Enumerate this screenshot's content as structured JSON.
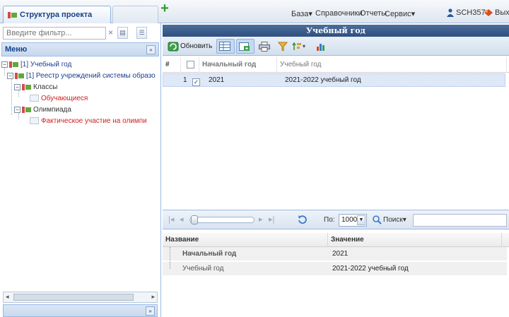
{
  "topbar": {
    "project_tab": "Структура проекта",
    "add_tab": "+",
    "menus": [
      "База▾",
      "Справочники",
      "Отчеты",
      "Сервис▾"
    ],
    "user": "SCH357",
    "exit": "Вых"
  },
  "left": {
    "filter_placeholder": "Введите фильтр...",
    "filter_clear": "×",
    "menu_title": "Меню",
    "tree": [
      {
        "label": "[1] Учебный год",
        "level": 0,
        "type": "folder",
        "color": "blue"
      },
      {
        "label": "[1] Реестр учреждений системы образо",
        "level": 1,
        "type": "folder",
        "color": "blue"
      },
      {
        "label": "Классы",
        "level": 2,
        "type": "folder",
        "color": "dark"
      },
      {
        "label": "Обучающиеся",
        "level": 3,
        "type": "leaf",
        "color": "red"
      },
      {
        "label": "Олимпиада",
        "level": 2,
        "type": "folder",
        "color": "dark"
      },
      {
        "label": "Фактическое участие на олимпи",
        "level": 3,
        "type": "leaf",
        "color": "red"
      }
    ]
  },
  "right": {
    "title": "Учебный год",
    "toolbar": {
      "refresh": "Обновить"
    },
    "grid": {
      "headers": [
        "#",
        "",
        "Начальный год",
        "Учебный год"
      ],
      "rows": [
        {
          "num": "1",
          "checked": "✓",
          "start_year": "2021",
          "academic_year": "2021-2022 учебный год"
        }
      ]
    },
    "paging": {
      "page_size_label": "По:",
      "page_size": "1000",
      "search": "Поиск▾"
    },
    "props": {
      "headers": [
        "Название",
        "Значение"
      ],
      "rows": [
        {
          "name": "Начальный год",
          "value": "2021"
        },
        {
          "name": "Учебный год",
          "value": "2021-2022 учебный год"
        }
      ]
    }
  },
  "colors": {
    "accent": "#99bbe8",
    "title_bar": "#3a5b8c",
    "red_text": "#d01f1f",
    "blue_text": "#1a3d8e"
  }
}
